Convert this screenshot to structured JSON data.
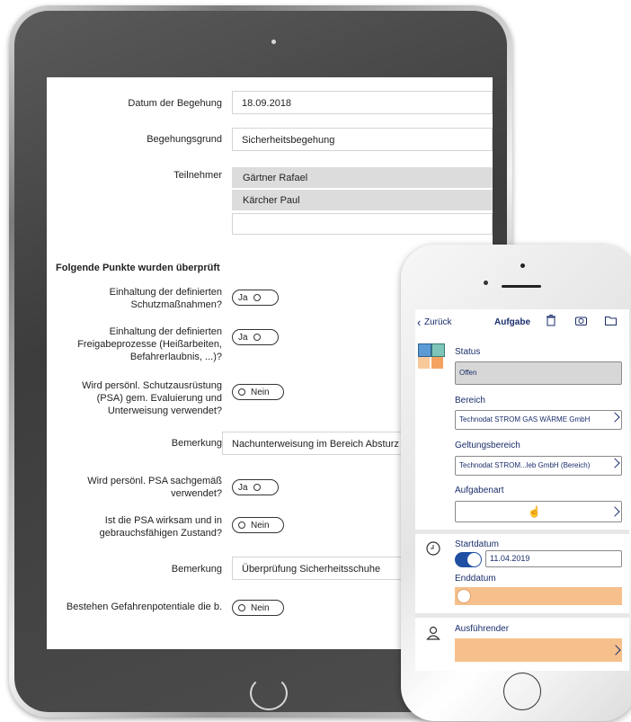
{
  "tablet_form": {
    "date_label": "Datum der Begehung",
    "date_value": "18.09.2018",
    "reason_label": "Begehungsgrund",
    "reason_value": "Sicherheitsbegehung",
    "participants_label": "Teilnehmer",
    "participants": [
      "Gärtner Rafael",
      "Kärcher Paul"
    ],
    "section_title": "Folgende Punkte wurden überprüft",
    "questions": [
      {
        "label": "Einhaltung der definierten Schutzmaßnahmen?",
        "answer": "Ja"
      },
      {
        "label": "Einhaltung der definierten Freigabeprozesse (Heißarbeiten, Befahrerlaubnis, ...)?",
        "answer": "Ja"
      },
      {
        "label": "Wird persönl. Schutzausrüstung (PSA) gem. Evaluierung und Unterweisung verwendet?",
        "answer": "Nein"
      },
      {
        "label": "Wird persönl. PSA sachgemäß verwendet?",
        "answer": "Ja"
      },
      {
        "label": "Ist die PSA wirksam und in gebrauchsfähigen Zustand?",
        "answer": "Nein"
      },
      {
        "label": "Bestehen Gefahrenpotentiale die b.",
        "answer": "Nein"
      }
    ],
    "remark_label": "Bemerkung",
    "remark_1": "Nachunterweisung im Bereich Absturz",
    "remark_2": "Überprüfung Sicherheitsschuhe"
  },
  "phone_app": {
    "back_label": "Zurück",
    "title": "Aufgabe",
    "status_label": "Status",
    "status_value": "Offen",
    "area_label": "Bereich",
    "area_value": "Technodat STROM GAS WÄRME GmbH",
    "scope_label": "Geltungsbereich",
    "scope_value": "Technodat STROM...leb GmbH (Bereich)",
    "tasktype_label": "Aufgabenart",
    "tasktype_value": "",
    "start_label": "Startdatum",
    "start_value": "11.04.2019",
    "end_label": "Enddatum",
    "assignee_label": "Ausführender",
    "colors": {
      "accent": "#1a2e6b",
      "toggle_on": "#1f4fa3",
      "orange": "#f6c08c",
      "status_bg": "#d7d7d7",
      "tile_blue": "#5b9bd5",
      "tile_teal": "#7fc4b8",
      "tile_orange": "#f4a261",
      "tile_peach": "#f7c99b"
    }
  }
}
